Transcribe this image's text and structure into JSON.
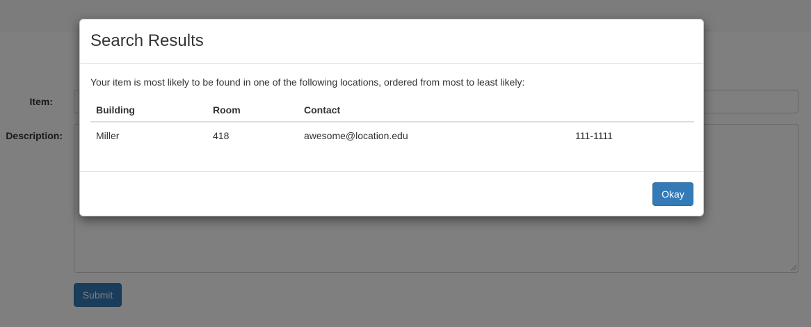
{
  "form": {
    "item_label": "Item:",
    "description_label": "Description:",
    "item_value": "",
    "description_value": "",
    "submit_label": "Submit"
  },
  "modal": {
    "title": "Search Results",
    "message": "Your item is most likely to be found in one of the following locations, ordered from most to least likely:",
    "table": {
      "headers": [
        "Building",
        "Room",
        "Contact",
        ""
      ],
      "rows": [
        [
          "Miller",
          "418",
          "awesome@location.edu",
          "111-1111"
        ]
      ]
    },
    "okay_label": "Okay"
  },
  "colors": {
    "primary": "#337ab7",
    "backdrop": "#000000"
  }
}
